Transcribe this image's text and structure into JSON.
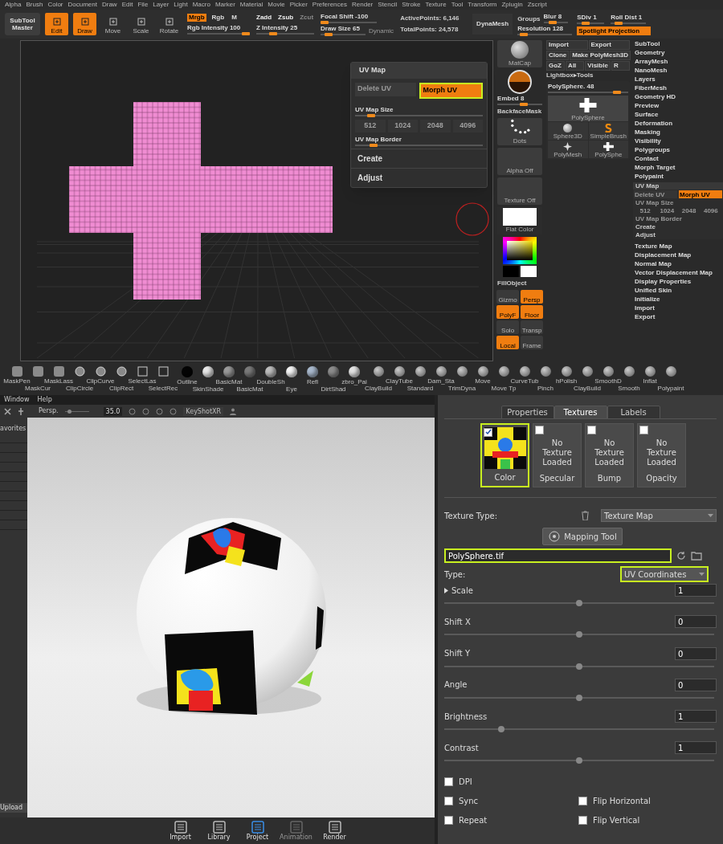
{
  "zbrush": {
    "menu": [
      "Alpha",
      "Brush",
      "Color",
      "Document",
      "Draw",
      "Edit",
      "File",
      "Layer",
      "Light",
      "Macro",
      "Marker",
      "Material",
      "Movie",
      "Picker",
      "Preferences",
      "Render",
      "Stencil",
      "Stroke",
      "Texture",
      "Tool",
      "Transform",
      "Zplugin",
      "Zscript"
    ],
    "subtool_master": "SubTool Master",
    "modes": [
      {
        "label": "Edit",
        "on": true
      },
      {
        "label": "Draw",
        "on": true
      },
      {
        "label": "Move",
        "on": false
      },
      {
        "label": "Scale",
        "on": false
      },
      {
        "label": "Rotate",
        "on": false
      }
    ],
    "channels": [
      {
        "label": "Mrgb",
        "on": true
      },
      {
        "label": "Rgb",
        "on": false
      },
      {
        "label": "M",
        "on": false
      }
    ],
    "rgb_intensity": {
      "label": "Rgb Intensity 100",
      "level": 1
    },
    "z_modes": [
      {
        "label": "Zadd",
        "disabled": false
      },
      {
        "label": "Zsub",
        "disabled": false
      },
      {
        "label": "Zcut",
        "disabled": true
      }
    ],
    "z_intensity": {
      "label": "Z Intensity 25",
      "level": 0.25
    },
    "focal_shift": {
      "label": "Focal Shift -100",
      "level": 0
    },
    "draw_size": {
      "label": "Draw Size 65",
      "level": 0.1
    },
    "dynamic": "Dynamic",
    "active_points": "ActivePoints: 6,146",
    "total_points": "TotalPoints: 24,578",
    "dynamesh": "DynaMesh",
    "groups": "Groups",
    "blur": {
      "label": "Blur 8",
      "level": 0.3
    },
    "resolution": {
      "label": "Resolution 128",
      "level": 0.05
    },
    "sdiv": {
      "label": "SDiv 1",
      "level": 0.25
    },
    "roll_dist": {
      "label": "Roll Dist 1",
      "level": 0.15
    },
    "spotlight": "Spotlight Projection",
    "tool_buttons": [
      [
        "Import",
        "Export"
      ],
      [
        "Clone",
        "Make PolyMesh3D"
      ],
      [
        "GoZ",
        "All",
        "Visible",
        "R"
      ]
    ],
    "lightbox": "Lightbox▸Tools",
    "uv_popup": {
      "title": "UV Map",
      "delete_uv": {
        "label": "Delete UV",
        "disabled": true
      },
      "morph_uv": {
        "label": "Morph UV",
        "highlighted": true
      },
      "size": {
        "label": "UV Map Size",
        "level": 0.1
      },
      "sizes": [
        "512",
        "1024",
        "2048",
        "4096"
      ],
      "border": {
        "label": "UV Map Border",
        "level": 0.12
      },
      "create": "Create",
      "adjust": "Adjust"
    },
    "left_shelf": [
      {
        "kind": "material",
        "label": "MatCap"
      },
      {
        "kind": "color-sphere",
        "label": "Embed 8",
        "level": 0.6
      },
      {
        "kind": "text",
        "label": "BackfaceMask"
      },
      {
        "kind": "stroke",
        "label": "Dots"
      },
      {
        "kind": "empty",
        "label": "Alpha Off"
      },
      {
        "kind": "empty",
        "label": "Texture Off"
      },
      {
        "kind": "swatch",
        "label": "Flat Color"
      },
      {
        "kind": "picker"
      },
      {
        "kind": "text",
        "label": "FillObject"
      }
    ],
    "view_buttons": [
      {
        "label": "Gizmo",
        "on": false
      },
      {
        "label": "Persp",
        "on": true
      },
      {
        "label": "PolyF",
        "on": true
      },
      {
        "label": "Floor",
        "on": true
      },
      {
        "label": "Solo",
        "on": false
      },
      {
        "label": "Transp",
        "on": false
      },
      {
        "label": "Local",
        "on": true
      },
      {
        "label": "Frame",
        "on": false
      }
    ],
    "polysphere": {
      "label": "PolySphere. 48",
      "level": 0.9
    },
    "big_thumb": "PolySphere",
    "thumbs": [
      {
        "label": "Sphere3D",
        "kind": "sphere"
      },
      {
        "label": "SimpleBrush",
        "kind": "s"
      },
      {
        "label": "PolyMesh",
        "kind": "star"
      },
      {
        "label": "PolySphe",
        "kind": "cross"
      }
    ],
    "palette_items": [
      "SubTool",
      "Geometry",
      "ArrayMesh",
      "NanoMesh",
      "Layers",
      "FiberMesh",
      "Geometry HD",
      "Preview",
      "Surface",
      "Deformation",
      "Masking",
      "Visibility",
      "Polygroups",
      "Contact",
      "Morph Target",
      "Polypaint"
    ],
    "uv_sub": {
      "title": "UV Map",
      "delete_uv": "Delete UV",
      "morph_uv": "Morph UV",
      "size_label": "UV Map Size",
      "sizes": [
        "512",
        "1024",
        "2048",
        "4096"
      ],
      "border_label": "UV Map Border",
      "create": "Create",
      "adjust": "Adjust"
    },
    "palette_items_after": [
      "Texture Map",
      "Displacement Map",
      "Normal Map",
      "Vector Displacement Map",
      "Display Properties",
      "Unified Skin",
      "Initialize",
      "Import",
      "Export"
    ],
    "brush_groups": [
      [
        {
          "label": "MaskPen",
          "kind": "mask"
        },
        {
          "label": "MaskCur",
          "kind": "mask"
        },
        {
          "label": "MaskLass",
          "kind": "mask"
        },
        {
          "label": "ClipCircle",
          "kind": "clip"
        },
        {
          "label": "ClipCurve",
          "kind": "clip"
        },
        {
          "label": "ClipRect",
          "kind": "clip"
        },
        {
          "label": "SelectLas",
          "kind": "select"
        },
        {
          "label": "SelectRec",
          "kind": "select"
        }
      ],
      [
        {
          "label": "Outline",
          "kind": "material",
          "color": "#050505"
        },
        {
          "label": "SkinShade",
          "kind": "material",
          "color": "#e8e8e8"
        },
        {
          "label": "BasicMat",
          "kind": "material",
          "color": "#9a9a9a"
        },
        {
          "label": "BasicMat",
          "kind": "material",
          "color": "#7a7a7a"
        },
        {
          "label": "DoubleSh",
          "kind": "material",
          "color": "#bdbdbd"
        },
        {
          "label": "Eye",
          "kind": "material",
          "color": "#f4f4f4"
        },
        {
          "label": "Refl",
          "kind": "material",
          "color": "#a8b8cc"
        },
        {
          "label": "DirtShad",
          "kind": "material",
          "color": "#8c8c8c"
        },
        {
          "label": "zbro_Pai",
          "kind": "material",
          "color": "#e2e2e2"
        }
      ],
      [
        {
          "label": "ClayBuild",
          "kind": "brush"
        },
        {
          "label": "ClayTube",
          "kind": "brush"
        },
        {
          "label": "Standard",
          "kind": "brush"
        },
        {
          "label": "Dam_Sta",
          "kind": "brush"
        },
        {
          "label": "TrimDyna",
          "kind": "brush"
        },
        {
          "label": "Move",
          "kind": "brush"
        },
        {
          "label": "Move Tp",
          "kind": "brush"
        },
        {
          "label": "CurveTub",
          "kind": "brush"
        },
        {
          "label": "Pinch",
          "kind": "brush"
        },
        {
          "label": "hPolish",
          "kind": "brush"
        },
        {
          "label": "ClayBuild",
          "kind": "brush"
        },
        {
          "label": "SmoothD",
          "kind": "brush"
        },
        {
          "label": "Smooth",
          "kind": "brush"
        },
        {
          "label": "Inflat",
          "kind": "brush"
        },
        {
          "label": "Polypaint",
          "kind": "brush"
        }
      ]
    ]
  },
  "keyshot": {
    "menu": [
      "Window",
      "Help"
    ],
    "persp": "Persp.",
    "fov": {
      "value": "35.0",
      "level": 0.1
    },
    "xr": "KeyShotXR",
    "sidebar_label": "avorites",
    "upload": "Upload",
    "nav": [
      {
        "label": "Import",
        "selected": false,
        "disabled": false
      },
      {
        "label": "Library",
        "selected": false,
        "disabled": false
      },
      {
        "label": "Project",
        "selected": true,
        "disabled": false
      },
      {
        "label": "Animation",
        "selected": false,
        "disabled": true
      },
      {
        "label": "Render",
        "selected": false,
        "disabled": false
      }
    ]
  },
  "texture_panel": {
    "tabs": [
      {
        "label": "Properties",
        "selected": false
      },
      {
        "label": "Textures",
        "selected": true
      },
      {
        "label": "Labels",
        "selected": false
      }
    ],
    "slots": [
      {
        "label": "Color",
        "loaded": true,
        "checked": true,
        "highlighted": true
      },
      {
        "label": "Specular",
        "loaded": false,
        "checked": false,
        "highlighted": false,
        "empty_text": "No Texture Loaded"
      },
      {
        "label": "Bump",
        "loaded": false,
        "checked": false,
        "highlighted": false,
        "empty_text": "No Texture Loaded"
      },
      {
        "label": "Opacity",
        "loaded": false,
        "checked": false,
        "highlighted": false,
        "empty_text": "No Texture Loaded"
      }
    ],
    "texture_type_label": "Texture Type:",
    "texture_type": "Texture Map",
    "mapping_tool": "Mapping Tool",
    "file": {
      "value": "PolySphere.tif",
      "highlighted": true
    },
    "type_label": "Type:",
    "type": {
      "value": "UV Coordinates",
      "highlighted": true
    },
    "sliders": [
      {
        "label": "Scale",
        "value": "1",
        "level": 0.5,
        "expandable": true
      },
      {
        "label": "Shift X",
        "value": "0",
        "level": 0.5,
        "expandable": false
      },
      {
        "label": "Shift Y",
        "value": "0",
        "level": 0.5,
        "expandable": false
      },
      {
        "label": "Angle",
        "value": "0",
        "level": 0.5,
        "expandable": false
      },
      {
        "label": "Brightness",
        "value": "1",
        "level": 0.21,
        "expandable": false
      },
      {
        "label": "Contrast",
        "value": "1",
        "level": 0.5,
        "expandable": false
      }
    ],
    "checkbox_rows": [
      [
        {
          "label": "DPI",
          "checked": false
        }
      ],
      [
        {
          "label": "Sync",
          "checked": false
        },
        {
          "label": "Flip Horizontal",
          "checked": false
        }
      ],
      [
        {
          "label": "Repeat",
          "checked": false
        },
        {
          "label": "Flip Vertical",
          "checked": false
        }
      ]
    ]
  }
}
